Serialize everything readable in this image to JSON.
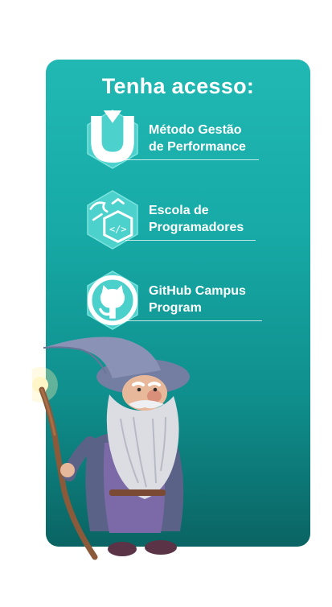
{
  "title": "Tenha acesso:",
  "items": [
    {
      "label": "Método Gestão\nde Performance",
      "icon": "shield-u-logo-icon"
    },
    {
      "label": "Escola de\nProgramadores",
      "icon": "code-hexagon-icon"
    },
    {
      "label": "GitHub Campus\nProgram",
      "icon": "github-icon"
    }
  ],
  "colors": {
    "card_top": "#21b8b4",
    "card_bottom": "#0a6463",
    "hex_fill": "#4fd3cd"
  },
  "illustration": "wizard-illustration"
}
